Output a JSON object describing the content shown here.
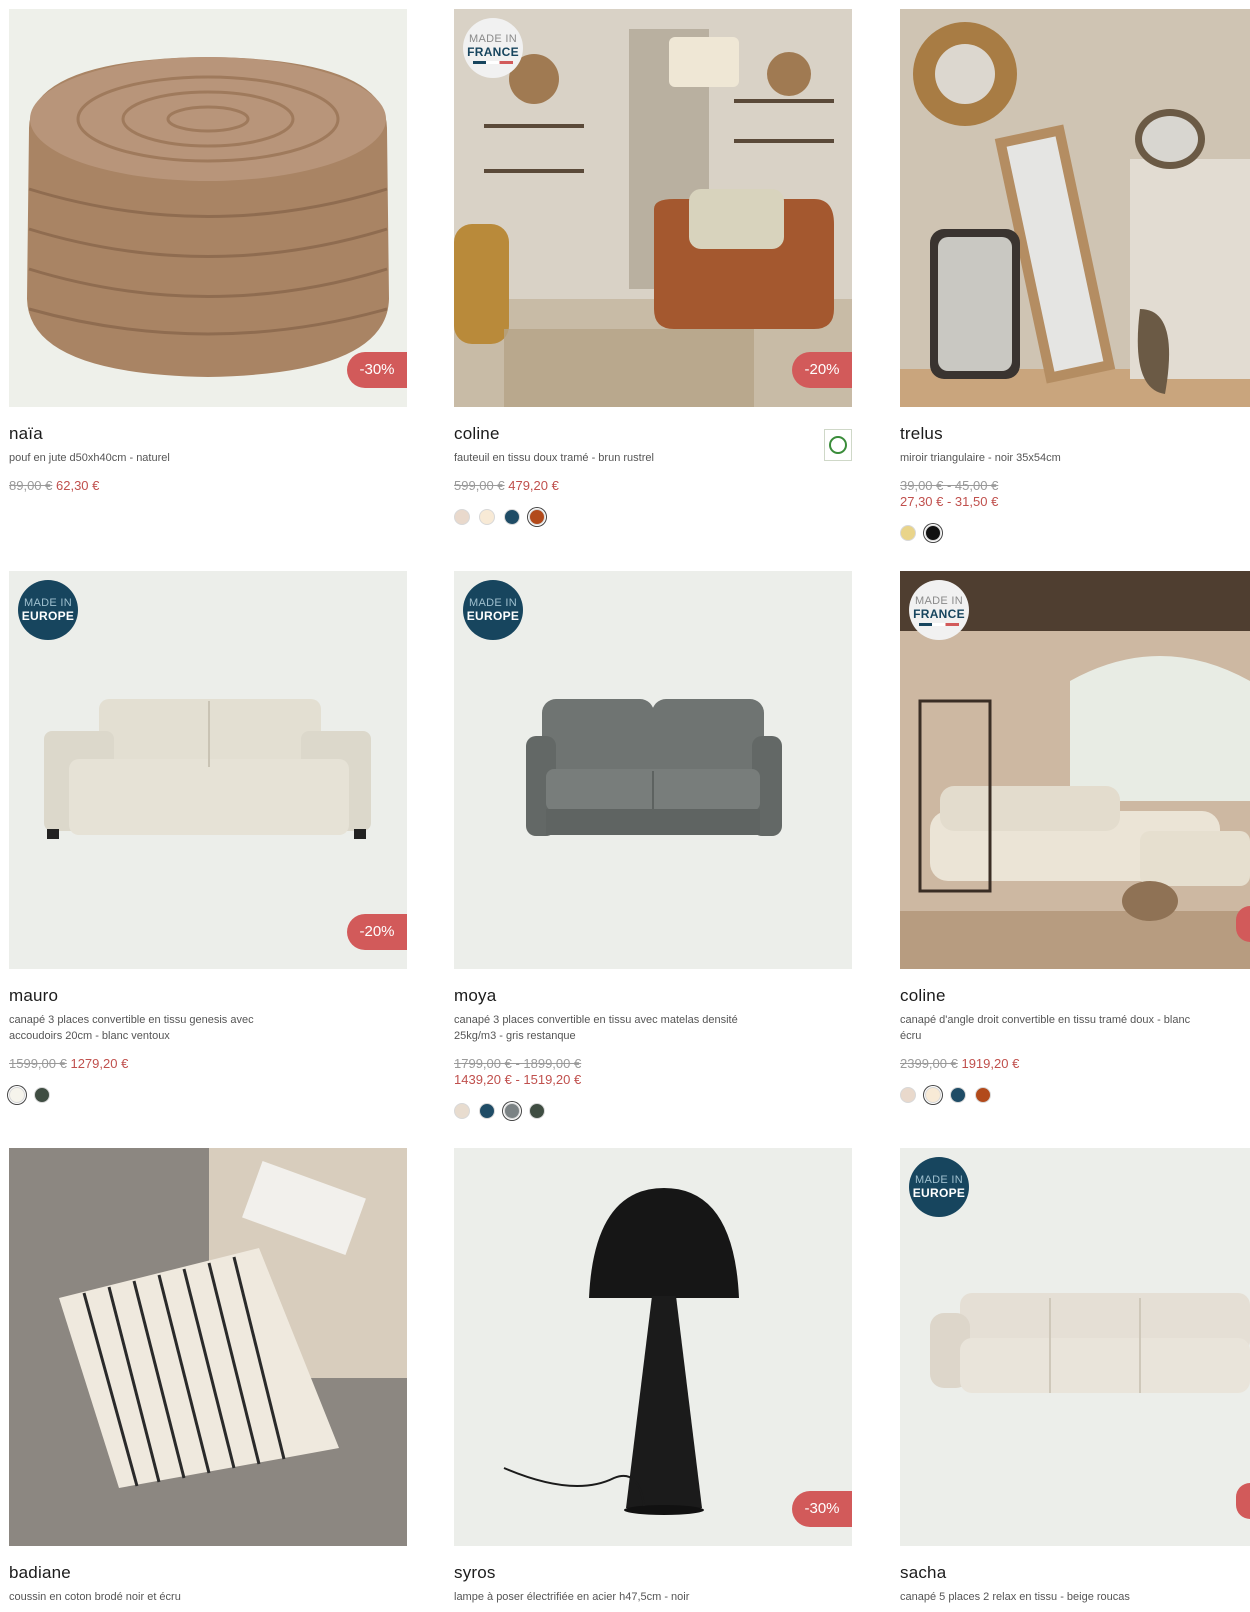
{
  "products": [
    {
      "name": "naïa",
      "desc": "pouf en jute d50xh40cm - naturel",
      "old": "89,00 €",
      "new": "62,30 €",
      "discount": "-30%",
      "made_in": null,
      "swatches": []
    },
    {
      "name": "coline",
      "desc": "fauteuil en tissu doux tramé - brun rustrel",
      "old": "599,00 €",
      "new": "479,20 €",
      "discount": "-20%",
      "made_in": {
        "l1": "MADE IN",
        "l2": "FRANCE"
      },
      "pefc": "PEFC",
      "swatches": [
        "#e9d9cc",
        "#f8ead6",
        "#1f4c66",
        "#b24a1b"
      ],
      "selected": 3
    },
    {
      "name": "trelus",
      "desc": "miroir triangulaire - noir 35x54cm",
      "old": "39,00 € - 45,00 €",
      "new": "27,30 € - 31,50 €",
      "discount": null,
      "made_in": null,
      "swatches": [
        "#e9d48a",
        "#111111"
      ],
      "selected": 1
    },
    {
      "name": "mauro",
      "desc": "canapé 3 places convertible en tissu genesis avec accoudoirs 20cm - blanc ventoux",
      "old": "1599,00 €",
      "new": "1279,20 €",
      "discount": "-20%",
      "made_in": {
        "l1": "MADE IN",
        "l2": "EUROPE"
      },
      "swatches": [
        "#f6f4ec",
        "#3f4d42"
      ],
      "selected": 0
    },
    {
      "name": "moya",
      "desc": "canapé 3 places convertible en tissu avec matelas densité 25kg/m3 - gris restanque",
      "old": "1799,00 € - 1899,00 €",
      "new": "1439,20 € - 1519,20 €",
      "discount": null,
      "made_in": {
        "l1": "MADE IN",
        "l2": "EUROPE"
      },
      "swatches": [
        "#e8dccf",
        "#1f4c66",
        "#7b8284",
        "#3f4d42"
      ],
      "selected": 2
    },
    {
      "name": "coline",
      "desc": "canapé d'angle droit convertible en tissu tramé doux - blanc écru",
      "old": "2399,00 €",
      "new": "1919,20 €",
      "discount": null,
      "made_in": {
        "l1": "MADE IN",
        "l2": "FRANCE"
      },
      "swatches": [
        "#e9d9cc",
        "#f8ead6",
        "#1f4c66",
        "#b24a1b"
      ],
      "selected": 1
    },
    {
      "name": "badiane",
      "desc": "coussin en coton brodé noir et écru",
      "old": "",
      "new": "",
      "discount": null,
      "made_in": null,
      "swatches": []
    },
    {
      "name": "syros",
      "desc": "lampe à poser électrifiée en acier h47,5cm - noir",
      "old": "",
      "new": "",
      "discount": "-30%",
      "made_in": null,
      "swatches": []
    },
    {
      "name": "sacha",
      "desc": "canapé 5 places 2 relax en tissu - beige roucas",
      "old": "",
      "new": "",
      "discount": null,
      "made_in": {
        "l1": "MADE IN",
        "l2": "EUROPE"
      },
      "swatches": []
    }
  ]
}
